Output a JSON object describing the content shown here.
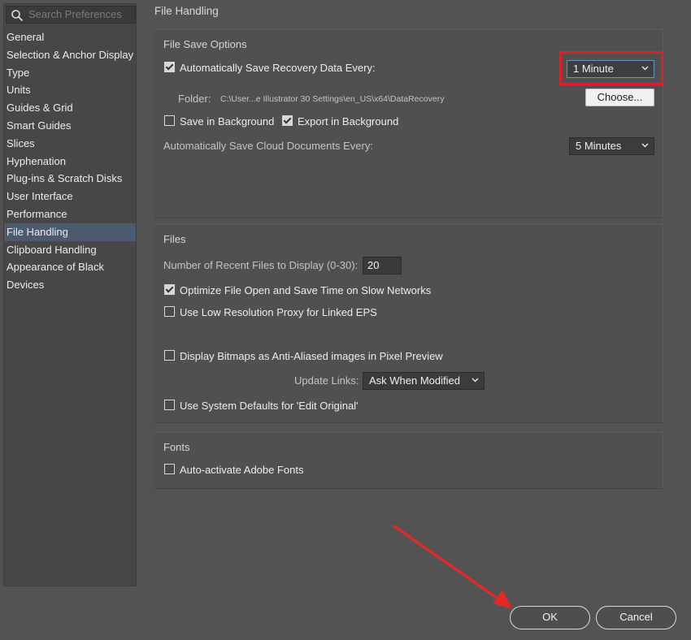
{
  "sidebar": {
    "search_placeholder": "Search Preferences",
    "items": [
      {
        "label": "General"
      },
      {
        "label": "Selection & Anchor Display"
      },
      {
        "label": "Type"
      },
      {
        "label": "Units"
      },
      {
        "label": "Guides & Grid"
      },
      {
        "label": "Smart Guides"
      },
      {
        "label": "Slices"
      },
      {
        "label": "Hyphenation"
      },
      {
        "label": "Plug-ins & Scratch Disks"
      },
      {
        "label": "User Interface"
      },
      {
        "label": "Performance"
      },
      {
        "label": "File Handling",
        "selected": true
      },
      {
        "label": "Clipboard Handling"
      },
      {
        "label": "Appearance of Black"
      },
      {
        "label": "Devices"
      }
    ]
  },
  "panel": {
    "title": "File Handling",
    "file_save": {
      "title": "File Save Options",
      "auto_save": {
        "label": "Automatically Save Recovery Data Every:",
        "checked": true,
        "value": "1 Minute"
      },
      "folder": {
        "label": "Folder:",
        "path": "C:\\User...e Illustrator 30 Settings\\en_US\\x64\\DataRecovery",
        "button": "Choose..."
      },
      "save_background": {
        "label": "Save in Background",
        "checked": false
      },
      "export_background": {
        "label": "Export in Background",
        "checked": true
      },
      "cloud": {
        "label": "Automatically Save Cloud Documents Every:",
        "value": "5 Minutes"
      }
    },
    "files": {
      "title": "Files",
      "recent": {
        "label": "Number of Recent Files to Display (0-30):",
        "value": "20"
      },
      "optimize": {
        "label": "Optimize File Open and Save Time on Slow Networks",
        "checked": true
      },
      "low_res": {
        "label": "Use Low Resolution Proxy for Linked EPS",
        "checked": false
      },
      "bitmaps": {
        "label": "Display Bitmaps as Anti-Aliased images in Pixel Preview",
        "checked": false
      },
      "update_links": {
        "label": "Update Links:",
        "value": "Ask When Modified"
      },
      "system_defaults": {
        "label": "Use System Defaults for 'Edit Original'",
        "checked": false
      }
    },
    "fonts": {
      "title": "Fonts",
      "auto_activate": {
        "label": "Auto-activate Adobe Fonts",
        "checked": false
      }
    }
  },
  "footer": {
    "ok": "OK",
    "cancel": "Cancel"
  },
  "colors": {
    "background": "#535353",
    "sidebar": "#474747",
    "selected": "#4b5a6f",
    "highlight": "#d9202b",
    "arrow": "#e02a2a"
  }
}
